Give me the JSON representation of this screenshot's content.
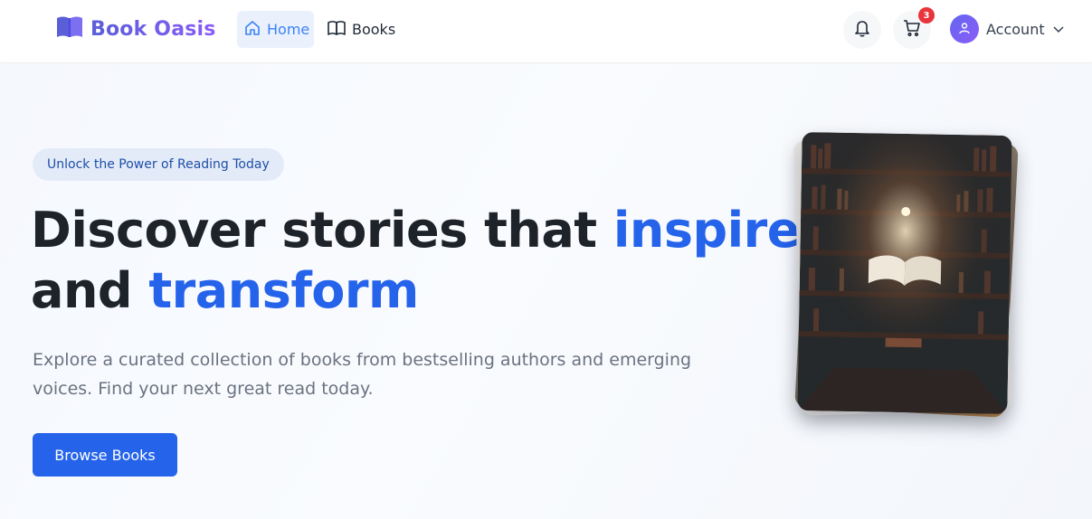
{
  "brand": {
    "name": "Book Oasis",
    "icon": "open-book-icon",
    "color": "#5a5fd8"
  },
  "nav": {
    "items": [
      {
        "label": "Home",
        "icon": "home-icon",
        "active": true
      },
      {
        "label": "Books",
        "icon": "book-icon",
        "active": false
      }
    ]
  },
  "header_actions": {
    "notifications_icon": "bell-icon",
    "cart_icon": "cart-icon",
    "cart_count": "3",
    "account_label": "Account",
    "account_icon": "user-icon",
    "account_chevron": "chevron-down-icon"
  },
  "hero": {
    "badge": "Unlock the Power of Reading Today",
    "headline_part1": "Discover stories that ",
    "headline_highlight1": "inspire",
    "headline_part2": "and ",
    "headline_highlight2": "transform",
    "description": "Explore a curated collection of books from bestselling authors and emerging voices. Find your next great read today.",
    "cta_label": "Browse Books"
  },
  "colors": {
    "accent": "#2563eb",
    "badge_bg": "#e4ebf8",
    "cart_badge": "#e8343a",
    "avatar_gradient_start": "#6366f1",
    "avatar_gradient_end": "#8b5cf6"
  }
}
